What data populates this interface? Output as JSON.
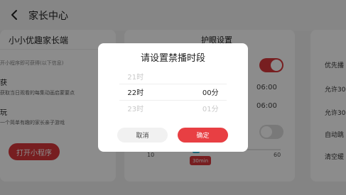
{
  "header": {
    "title": "家长中心",
    "back_icon": "chevron-left-icon"
  },
  "left_card": {
    "app_name": "小小优趣家长端",
    "note": "开小程序即可获得(以下信息)",
    "feature1": {
      "title": "获",
      "desc": "获取当日观看的每集动画启蒙要点"
    },
    "feature2": {
      "title": "玩",
      "desc": "一个简单有趣的家长亲子游戏"
    },
    "open_button": "打开小程序"
  },
  "mid_card": {
    "title": "护眼设置",
    "time_top": "06:00",
    "time_bottom": "06:00",
    "slider": {
      "min": "10",
      "max": "60",
      "value_label": "30min",
      "value": 30
    },
    "toggle_top_on": true,
    "toggle_bottom_on": false
  },
  "right_card": {
    "items": [
      "优先播",
      "允许30",
      "允许30",
      "自动跳",
      "清空缓"
    ]
  },
  "modal": {
    "title": "请设置禁播时段",
    "rows": [
      {
        "hour": "21时",
        "minute": ""
      },
      {
        "hour": "22时",
        "minute": "00分"
      },
      {
        "hour": "23时",
        "minute": "01分"
      }
    ],
    "cancel": "取消",
    "confirm": "确定"
  },
  "colors": {
    "accent": "#d9383b",
    "confirm": "#e83f43",
    "slider_thumb": "#33b4d4"
  }
}
